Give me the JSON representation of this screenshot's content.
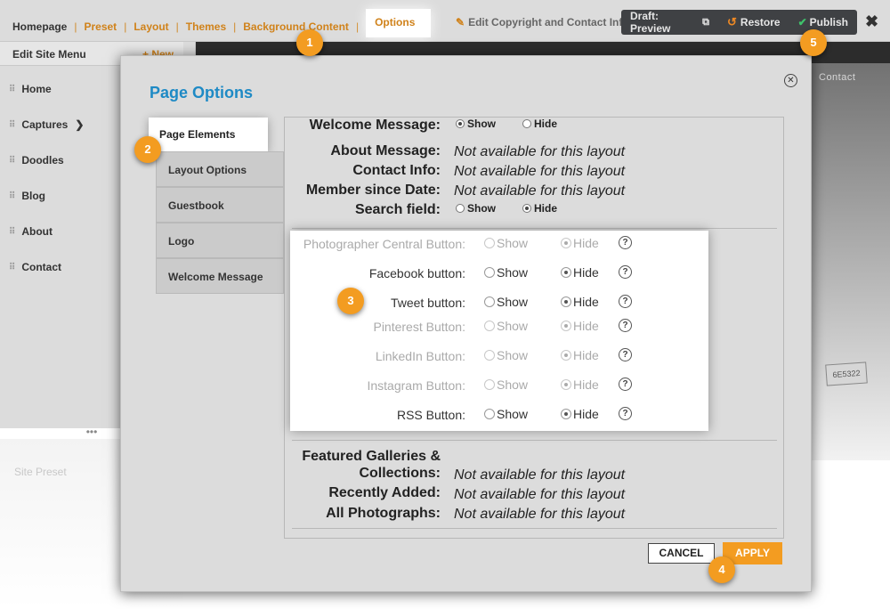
{
  "nav": {
    "home": "Homepage",
    "items": [
      "Preset",
      "Layout",
      "Themes",
      "Background Content",
      "Options"
    ]
  },
  "header": {
    "edit_copyright": "Edit Copyright and Contact Info",
    "draft_preview": "Draft: Preview",
    "restore": "Restore",
    "publish": "Publish",
    "close": "✖"
  },
  "sidebar": {
    "title": "Edit Site Menu",
    "new_button": "+ New",
    "items": [
      {
        "label": "Home"
      },
      {
        "label": "Captures",
        "has_children": true
      },
      {
        "label": "Doodles"
      },
      {
        "label": "Blog"
      },
      {
        "label": "About"
      },
      {
        "label": "Contact"
      }
    ],
    "more": "•••",
    "site_preset": "Site Preset"
  },
  "background": {
    "nav_contact": "Contact",
    "plate_text": "6E5322"
  },
  "modal": {
    "title": "Page Options",
    "close": "⊗",
    "tabs": [
      "Page Elements",
      "Layout Options",
      "Guestbook",
      "Logo",
      "Welcome Message"
    ],
    "active_tab": "Page Elements",
    "not_available": "Not available for this layout",
    "show": "Show",
    "hide": "Hide",
    "welcome_message": {
      "label": "Welcome Message:",
      "selected": "Show"
    },
    "about_message": "About Message:",
    "contact_info": "Contact Info:",
    "member_since": "Member since Date:",
    "search_field": {
      "label": "Search field:",
      "selected": "Hide"
    },
    "social_buttons": [
      {
        "label": "Photographer Central Button:",
        "selected": "Hide",
        "enabled": false
      },
      {
        "label": "Facebook button:",
        "selected": "Hide",
        "enabled": true
      },
      {
        "label": "Tweet button:",
        "selected": "Hide",
        "enabled": true
      },
      {
        "label": "Pinterest Button:",
        "selected": "Hide",
        "enabled": false
      },
      {
        "label": "LinkedIn Button:",
        "selected": "Hide",
        "enabled": false
      },
      {
        "label": "Instagram Button:",
        "selected": "Hide",
        "enabled": false
      },
      {
        "label": "RSS Button:",
        "selected": "Hide",
        "enabled": true
      }
    ],
    "featured_galleries": "Featured Galleries &",
    "featured_galleries_2": "Collections:",
    "recently_added": "Recently Added:",
    "all_photographs": "All Photographs:",
    "cancel": "CANCEL",
    "apply": "APPLY"
  },
  "callouts": [
    "1",
    "2",
    "3",
    "4",
    "5"
  ],
  "colors": {
    "accent": "#f39c21",
    "title_blue": "#1e8ac5",
    "nav_orange": "#d0821a"
  }
}
